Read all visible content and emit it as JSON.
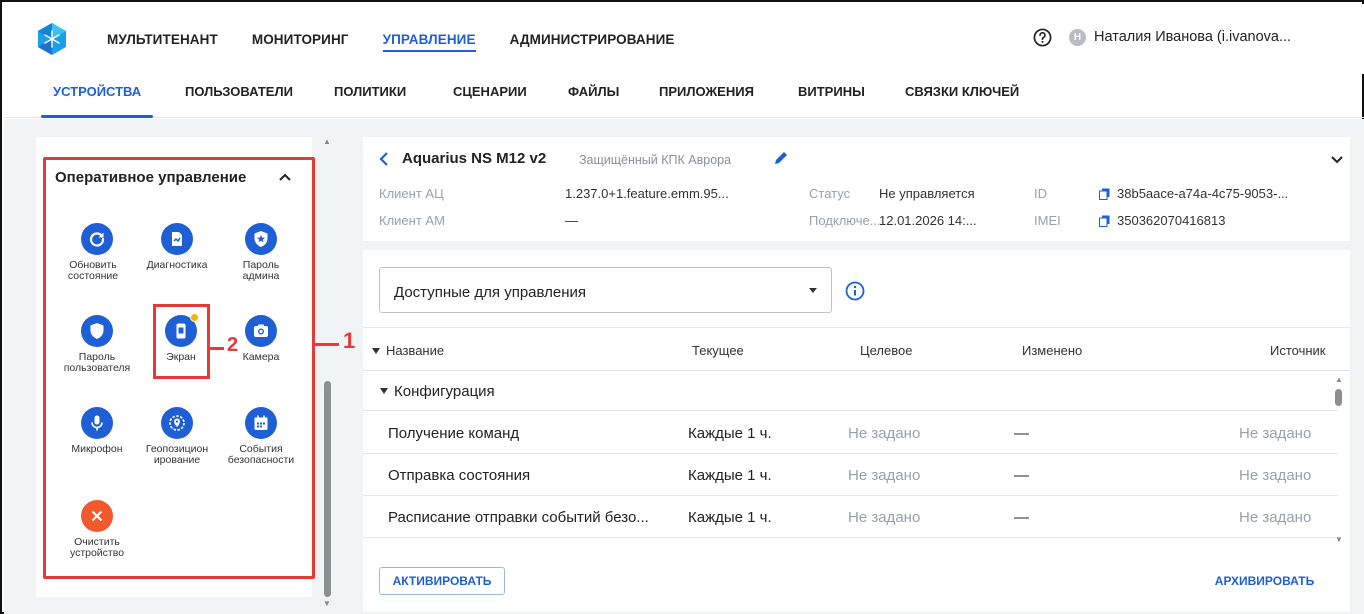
{
  "topnav": {
    "items": [
      "МУЛЬТИТЕНАНТ",
      "МОНИТОРИНГ",
      "УПРАВЛЕНИЕ",
      "АДМИНИСТРИРОВАНИЕ"
    ],
    "active": "УПРАВЛЕНИЕ"
  },
  "user": {
    "initial": "Н",
    "name": "Наталия Иванова (i.ivanova..."
  },
  "subtabs": {
    "items": [
      "УСТРОЙСТВА",
      "ПОЛЬЗОВАТЕЛИ",
      "ПОЛИТИКИ",
      "СЦЕНАРИИ",
      "ФАЙЛЫ",
      "ПРИЛОЖЕНИЯ",
      "ВИТРИНЫ",
      "СВЯЗКИ КЛЮЧЕЙ"
    ],
    "active": "УСТРОЙСТВА"
  },
  "panel": {
    "title": "Оперативное управление",
    "actions": [
      {
        "label": "Обновить состояние",
        "icon": "refresh-icon"
      },
      {
        "label": "Диагностика",
        "icon": "diagnostics-icon"
      },
      {
        "label": "Пароль админа",
        "icon": "admin-shield-icon"
      },
      {
        "label": "Пароль пользователя",
        "icon": "user-shield-icon"
      },
      {
        "label": "Экран",
        "icon": "screen-icon",
        "badge": true
      },
      {
        "label": "Камера",
        "icon": "camera-icon"
      },
      {
        "label": "Микрофон",
        "icon": "microphone-icon"
      },
      {
        "label": "Геопозиционирование",
        "icon": "location-icon"
      },
      {
        "label": "События безопасности",
        "icon": "calendar-icon"
      },
      {
        "label": "Очистить устройство",
        "icon": "close-icon"
      }
    ]
  },
  "annotations": {
    "one": "1",
    "two": "2"
  },
  "device": {
    "name": "Aquarius NS M12 v2",
    "model": "Защищённый КПК Аврора",
    "fields": {
      "client_ac_label": "Клиент АЦ",
      "client_ac_value": "1.237.0+1.feature.emm.95...",
      "client_am_label": "Клиент АМ",
      "client_am_value": "—",
      "status_label": "Статус",
      "status_value": "Не управляется",
      "connected_label": "Подключе...",
      "connected_value": "12.01.2026 14:...",
      "id_label": "ID",
      "id_value": "38b5aace-a74a-4c75-9053-...",
      "imei_label": "IMEI",
      "imei_value": "350362070416813"
    }
  },
  "filter": {
    "value": "Доступные для управления"
  },
  "table": {
    "columns": [
      "Название",
      "Текущее",
      "Целевое",
      "Изменено",
      "Источник"
    ],
    "group": "Конфигурация",
    "rows": [
      {
        "name": "Получение команд",
        "current": "Каждые 1 ч.",
        "target": "Не задано",
        "changed": "—",
        "source": "Не задано"
      },
      {
        "name": "Отправка состояния",
        "current": "Каждые 1 ч.",
        "target": "Не задано",
        "changed": "—",
        "source": "Не задано"
      },
      {
        "name": "Расписание отправки событий безо...",
        "current": "Каждые 1 ч.",
        "target": "Не задано",
        "changed": "—",
        "source": "Не задано"
      }
    ]
  },
  "buttons": {
    "activate": "АКТИВИРОВАТЬ",
    "archive": "АРХИВИРОВАТЬ"
  },
  "colors": {
    "accent": "#1e5fd6",
    "danger": "#f25a2e",
    "annotation": "#e63a3a",
    "badge": "#f4b400"
  }
}
